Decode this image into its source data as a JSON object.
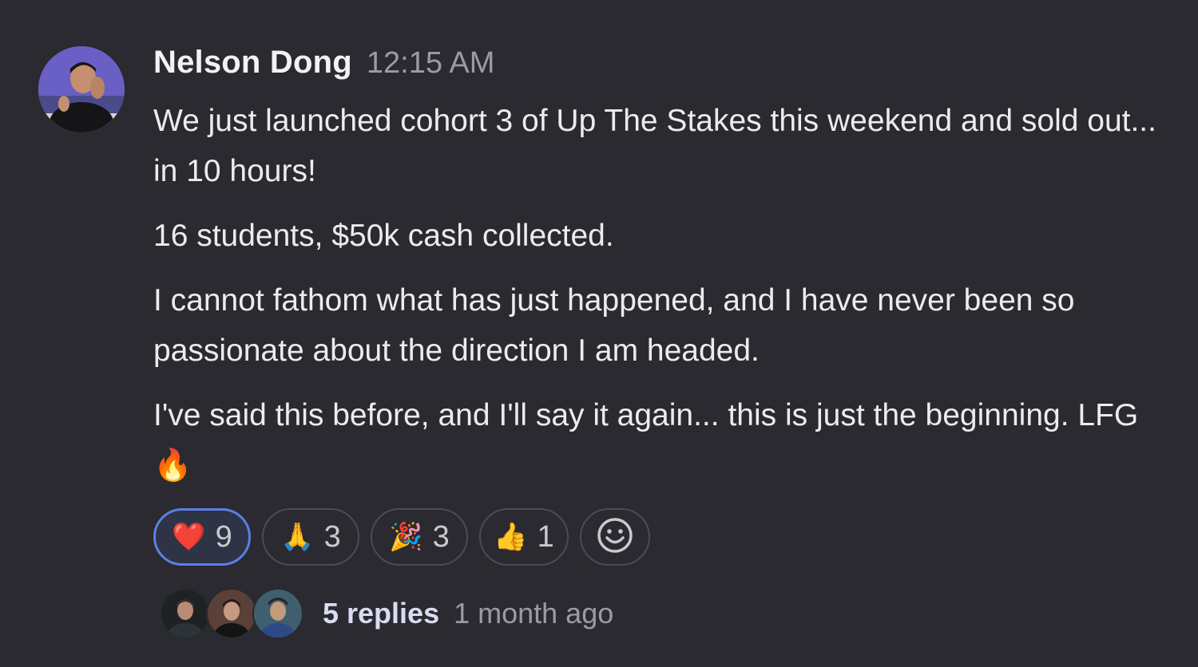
{
  "message": {
    "author": "Nelson Dong",
    "timestamp": "12:15 AM",
    "paragraphs": [
      "We just launched cohort 3 of Up The Stakes this weekend and sold out... in 10 hours!",
      "16 students, $50k cash collected.",
      "I cannot fathom what has just happened, and I have never been so passionate about the direction I am headed.",
      "I've said this before, and I'll say it again... this is just the beginning. LFG 🔥"
    ]
  },
  "reactions": [
    {
      "emoji": "❤️",
      "icon": "heart-icon",
      "count": "9",
      "active": true
    },
    {
      "emoji": "🙏",
      "icon": "folded-hands-icon",
      "count": "3",
      "active": false
    },
    {
      "emoji": "🎉",
      "icon": "party-popper-icon",
      "count": "3",
      "active": false
    },
    {
      "emoji": "👍",
      "icon": "thumbs-up-icon",
      "count": "1",
      "active": false
    }
  ],
  "add_reaction_icon": "smiley-face-icon",
  "thread": {
    "replies": "5 replies",
    "last_reply": "1 month ago"
  },
  "colors": {
    "background": "#2a2a30",
    "active_reaction_border": "#5b7fe8",
    "muted_text": "#9b9ba3"
  }
}
